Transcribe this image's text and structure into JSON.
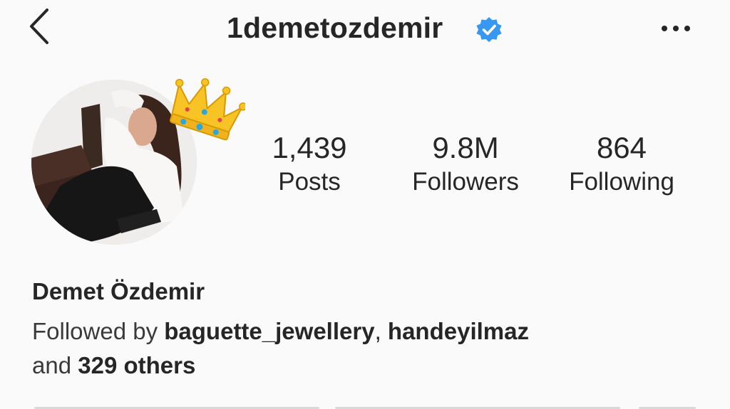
{
  "header": {
    "username": "1demetozdemir",
    "verified_icon": "verified-badge-icon",
    "back_icon": "chevron-left-icon",
    "more_icon": "more-horizontal-icon",
    "accent_color": "#3897f0"
  },
  "profile": {
    "avatar_decoration": "crown-emoji"
  },
  "stats": {
    "posts": {
      "value": "1,439",
      "label": "Posts"
    },
    "followers": {
      "value": "9.8M",
      "label": "Followers"
    },
    "following": {
      "value": "864",
      "label": "Following"
    }
  },
  "bio": {
    "full_name": "Demet Özdemir",
    "followed_by_prefix": "Followed by",
    "follower_1": "baguette_jewellery",
    "separator": ",",
    "follower_2": "handeyilmaz",
    "and_text": "and",
    "others": "329 others"
  }
}
